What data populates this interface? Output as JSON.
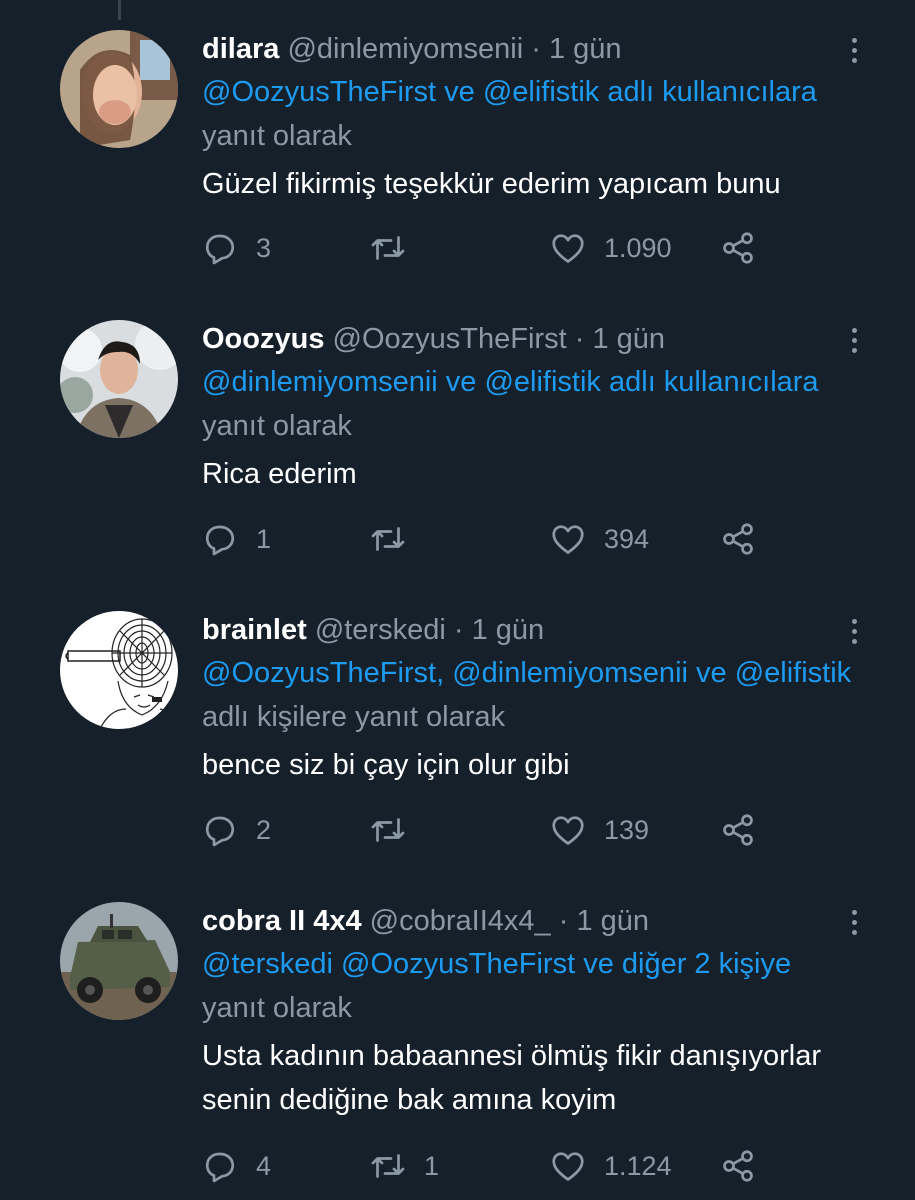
{
  "tweets": [
    {
      "name": "dilara",
      "handle": "@dinlemiyomsenii",
      "sep": "·",
      "time": "1 gün",
      "reply_mentions": "@OozyusTheFirst ve @elifistik adlı kullanıcılara",
      "reply_suffix": " yanıt olarak",
      "text": "Güzel fikirmiş teşekkür ederim yapıcam bunu",
      "replies": "3",
      "retweets": "",
      "likes": "1.090"
    },
    {
      "name": "Ooozyus",
      "handle": "@OozyusTheFirst",
      "sep": "·",
      "time": "1 gün",
      "reply_mentions": "@dinlemiyomsenii ve @elifistik adlı kullanıcılara",
      "reply_suffix": " yanıt olarak",
      "text": "Rica ederim",
      "replies": "1",
      "retweets": "",
      "likes": "394"
    },
    {
      "name": "brainlet",
      "handle": "@terskedi",
      "sep": "·",
      "time": "1 gün",
      "reply_mentions": "@OozyusTheFirst, @dinlemiyomsenii ve @elifistik",
      "reply_suffix": " adlı kişilere yanıt olarak",
      "text": "bence siz bi çay için olur gibi",
      "replies": "2",
      "retweets": "",
      "likes": "139"
    },
    {
      "name": "cobra II 4x4",
      "handle": "@cobraII4x4_",
      "sep": "·",
      "time": "1 gün",
      "reply_mentions": "@terskedi @OozyusTheFirst ve diğer 2 kişiye",
      "reply_suffix": " yanıt olarak",
      "text": "Usta kadının babaannesi ölmüş fikir danışıyorlar senin dediğine bak amına koyim",
      "replies": "4",
      "retweets": "1",
      "likes": "1.124"
    }
  ],
  "colors": {
    "background": "#15202b",
    "text": "#ffffff",
    "muted": "#8b98a5",
    "link": "#1d9bf0"
  },
  "icons": [
    "reply-icon",
    "retweet-icon",
    "like-icon",
    "share-icon",
    "more-icon"
  ]
}
